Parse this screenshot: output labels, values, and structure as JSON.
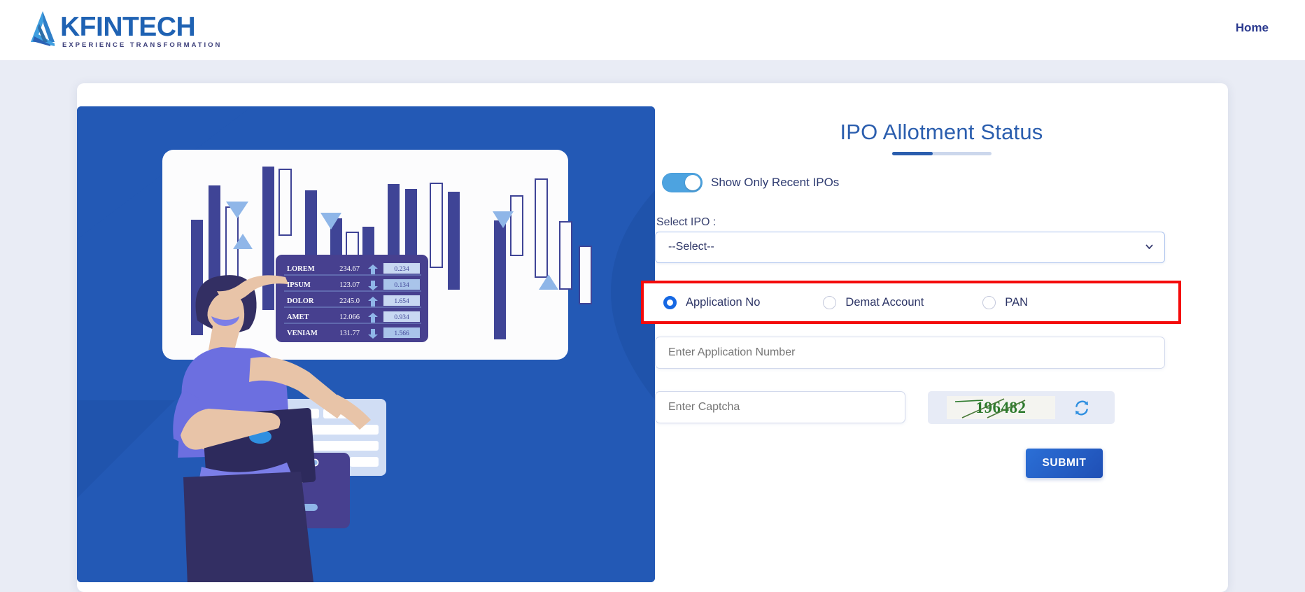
{
  "header": {
    "logo_word": "KFINTECH",
    "logo_tagline": "EXPERIENCE TRANSFORMATION",
    "nav": {
      "home": "Home"
    }
  },
  "form": {
    "title": "IPO Allotment Status",
    "toggle": {
      "label": "Show Only Recent IPOs",
      "state": "on"
    },
    "select_ipo": {
      "label": "Select IPO :",
      "selected": "--Select--",
      "options": [
        "--Select--"
      ]
    },
    "search_by": {
      "selected": "Application No",
      "options": [
        {
          "label": "Application No",
          "checked": true
        },
        {
          "label": "Demat Account",
          "checked": false
        },
        {
          "label": "PAN",
          "checked": false
        }
      ]
    },
    "application_number": {
      "placeholder": "Enter Application Number",
      "value": ""
    },
    "captcha_input": {
      "placeholder": "Enter Captcha",
      "value": ""
    },
    "captcha_code": "196482",
    "refresh_icon": "refresh-icon",
    "submit_label": "SUBMIT"
  },
  "illustration": {
    "alt": "Investor with laptop viewing stock charts",
    "ticker_table": {
      "columns": [
        "symbol",
        "price",
        "direction",
        "change"
      ],
      "rows": [
        {
          "symbol": "LOREM",
          "price": "234.67",
          "direction": "up",
          "change": "0.234"
        },
        {
          "symbol": "IPSUM",
          "price": "123.07",
          "direction": "down",
          "change": "0.134"
        },
        {
          "symbol": "DOLOR",
          "price": "2245.0",
          "direction": "up",
          "change": "1.654"
        },
        {
          "symbol": "AMET",
          "price": "12.066",
          "direction": "up",
          "change": "0.934"
        },
        {
          "symbol": "VENIAM",
          "price": "131.77",
          "direction": "down",
          "change": "1.566"
        }
      ]
    }
  },
  "colors": {
    "brand_blue": "#1f62b3",
    "panel_blue": "#2359b5",
    "title_blue": "#2b5eae",
    "accent_toggle": "#4da3e0",
    "highlight_red": "#f40b0b",
    "captcha_green": "#2d7a2d",
    "page_bg": "#e9ecf5"
  }
}
